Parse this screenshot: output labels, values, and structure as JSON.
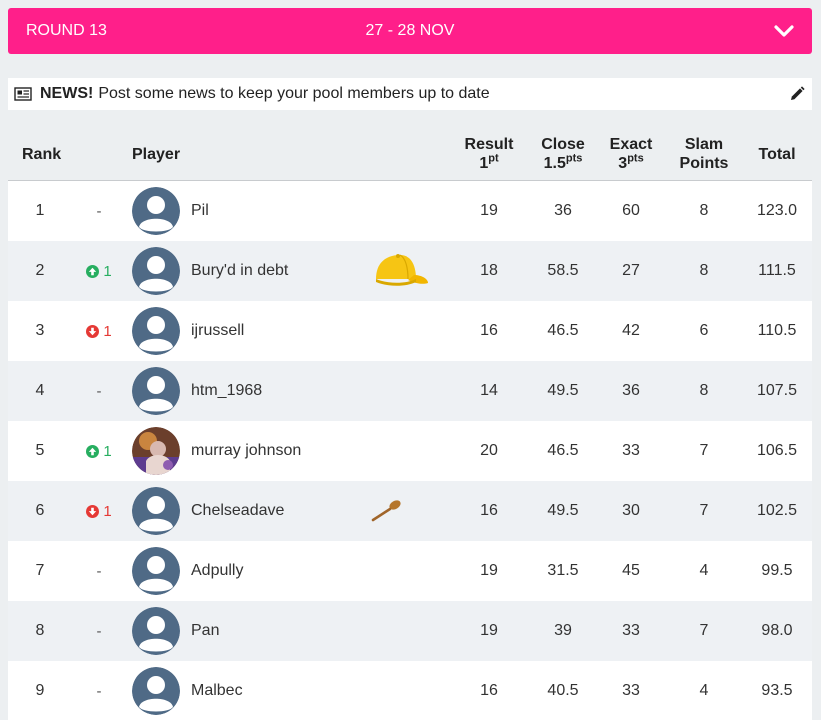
{
  "round": {
    "label": "ROUND 13",
    "dates": "27 - 28 NOV"
  },
  "news": {
    "title": "NEWS!",
    "text": "Post some news to keep your pool members up to date"
  },
  "columns": {
    "rank": "Rank",
    "player": "Player",
    "result": "Result",
    "result_pts": "1",
    "result_sup": "pt",
    "close": "Close",
    "close_pts": "1.5",
    "close_sup": "pts",
    "exact": "Exact",
    "exact_pts": "3",
    "exact_sup": "pts",
    "slam": "Slam",
    "slam2": "Points",
    "total": "Total"
  },
  "rows": [
    {
      "rank": "1",
      "move": "-",
      "dir": "same",
      "avatar": "default-avatar",
      "name": "Pil",
      "badge": "",
      "result": "19",
      "close": "36",
      "exact": "60",
      "slam": "8",
      "total": "123.0"
    },
    {
      "rank": "2",
      "move": "1",
      "dir": "up",
      "avatar": "default-avatar",
      "name": "Bury'd in debt",
      "badge": "yellow-cap-icon",
      "result": "18",
      "close": "58.5",
      "exact": "27",
      "slam": "8",
      "total": "111.5"
    },
    {
      "rank": "3",
      "move": "1",
      "dir": "down",
      "avatar": "default-avatar",
      "name": "ijrussell",
      "badge": "",
      "result": "16",
      "close": "46.5",
      "exact": "42",
      "slam": "6",
      "total": "110.5"
    },
    {
      "rank": "4",
      "move": "-",
      "dir": "same",
      "avatar": "default-avatar",
      "name": "htm_1968",
      "badge": "",
      "result": "14",
      "close": "49.5",
      "exact": "36",
      "slam": "8",
      "total": "107.5"
    },
    {
      "rank": "5",
      "move": "1",
      "dir": "up",
      "avatar": "photo-avatar",
      "name": "murray johnson",
      "badge": "",
      "result": "20",
      "close": "46.5",
      "exact": "33",
      "slam": "7",
      "total": "106.5"
    },
    {
      "rank": "6",
      "move": "1",
      "dir": "down",
      "avatar": "default-avatar",
      "name": "Chelseadave",
      "badge": "wooden-spoon-icon",
      "result": "16",
      "close": "49.5",
      "exact": "30",
      "slam": "7",
      "total": "102.5"
    },
    {
      "rank": "7",
      "move": "-",
      "dir": "same",
      "avatar": "default-avatar",
      "name": "Adpully",
      "badge": "",
      "result": "19",
      "close": "31.5",
      "exact": "45",
      "slam": "4",
      "total": "99.5"
    },
    {
      "rank": "8",
      "move": "-",
      "dir": "same",
      "avatar": "default-avatar",
      "name": "Pan",
      "badge": "",
      "result": "19",
      "close": "39",
      "exact": "33",
      "slam": "7",
      "total": "98.0"
    },
    {
      "rank": "9",
      "move": "-",
      "dir": "same",
      "avatar": "default-avatar",
      "name": "Malbec",
      "badge": "",
      "result": "16",
      "close": "40.5",
      "exact": "33",
      "slam": "4",
      "total": "93.5"
    }
  ],
  "colors": {
    "accent": "#ff1f8a",
    "up": "#27ae60",
    "down": "#e53935",
    "avatar": "#4f6a86"
  }
}
